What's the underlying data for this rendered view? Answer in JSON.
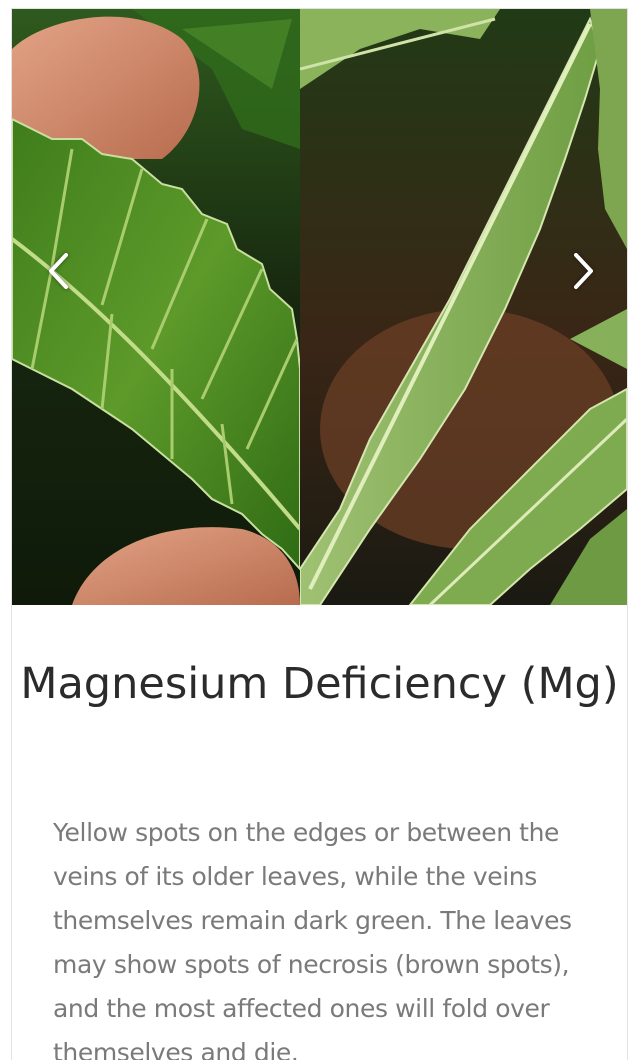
{
  "carousel": {
    "slides": [
      "left-leaf-photo",
      "right-leaf-photo"
    ],
    "prev_icon": "chevron-left-icon",
    "next_icon": "chevron-right-icon"
  },
  "article": {
    "title": "Magnesium Deficiency (Mg)",
    "description": "Yellow spots on the edges or between the veins of its older leaves, while the veins themselves remain dark green. The leaves may show spots of necrosis (brown spots), and the most affected ones will fold over themselves and die."
  },
  "colors": {
    "title_text": "#2b2b2b",
    "body_text": "#7a7a7a",
    "leaf_green": "#4f8a24",
    "leaf_light": "#a8c76e"
  }
}
